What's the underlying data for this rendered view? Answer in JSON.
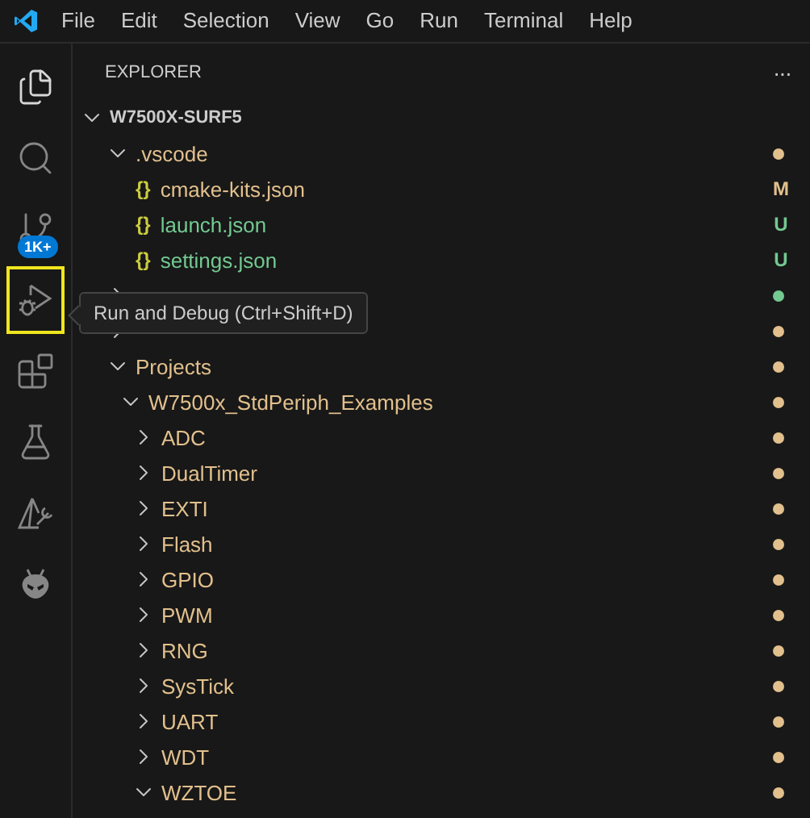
{
  "menu_bar": [
    "File",
    "Edit",
    "Selection",
    "View",
    "Go",
    "Run",
    "Terminal",
    "Help"
  ],
  "activity_bar": [
    {
      "kind": "explorer",
      "selected": true,
      "focused": false
    },
    {
      "kind": "search",
      "selected": false,
      "focused": false
    },
    {
      "kind": "source-control",
      "selected": false,
      "focused": false,
      "badge": "1K+"
    },
    {
      "kind": "run-debug",
      "selected": false,
      "focused": true
    },
    {
      "kind": "extensions",
      "selected": false,
      "focused": false
    },
    {
      "kind": "testing",
      "selected": false,
      "focused": false
    },
    {
      "kind": "cmake",
      "selected": false,
      "focused": false
    },
    {
      "kind": "platformio",
      "selected": false,
      "focused": false
    }
  ],
  "tooltip": "Run and Debug (Ctrl+Shift+D)",
  "explorer": {
    "title": "EXPLORER",
    "more": "···",
    "root": {
      "label": "W7500X-SURF5",
      "expanded": true,
      "children": [
        {
          "kind": "folder",
          "label": ".vscode",
          "expanded": true,
          "color": "#e2c08d",
          "children": [
            {
              "kind": "file",
              "icon": "{}",
              "label": "cmake-kits.json",
              "color": "#e2c08d",
              "badge": "M"
            },
            {
              "kind": "file",
              "icon": "{}",
              "label": "launch.json",
              "color": "#73c991",
              "badge": "U"
            },
            {
              "kind": "file",
              "icon": "{}",
              "label": "settings.json",
              "color": "#73c991",
              "badge": "U"
            }
          ]
        },
        {
          "kind": "folder",
          "expanded": false,
          "color": "#73c991"
        },
        {
          "kind": "folder",
          "expanded": false,
          "color": "#e2c08d"
        },
        {
          "kind": "folder",
          "label": "Projects",
          "expanded": true,
          "color": "#e2c08d",
          "children": [
            {
              "kind": "folder",
              "label": "W7500x_StdPeriph_Examples",
              "expanded": true,
              "color": "#e2c08d",
              "children": [
                {
                  "kind": "folder",
                  "label": "ADC",
                  "expanded": false,
                  "color": "#e2c08d"
                },
                {
                  "kind": "folder",
                  "label": "DualTimer",
                  "expanded": false,
                  "color": "#e2c08d"
                },
                {
                  "kind": "folder",
                  "label": "EXTI",
                  "expanded": false,
                  "color": "#e2c08d"
                },
                {
                  "kind": "folder",
                  "label": "Flash",
                  "expanded": false,
                  "color": "#e2c08d"
                },
                {
                  "kind": "folder",
                  "label": "GPIO",
                  "expanded": false,
                  "color": "#e2c08d"
                },
                {
                  "kind": "folder",
                  "label": "PWM",
                  "expanded": false,
                  "color": "#e2c08d"
                },
                {
                  "kind": "folder",
                  "label": "RNG",
                  "expanded": false,
                  "color": "#e2c08d"
                },
                {
                  "kind": "folder",
                  "label": "SysTick",
                  "expanded": false,
                  "color": "#e2c08d"
                },
                {
                  "kind": "folder",
                  "label": "UART",
                  "expanded": false,
                  "color": "#e2c08d"
                },
                {
                  "kind": "folder",
                  "label": "WDT",
                  "expanded": false,
                  "color": "#e2c08d"
                },
                {
                  "kind": "folder",
                  "label": "WZTOE",
                  "expanded": true,
                  "color": "#e2c08d"
                }
              ]
            }
          ]
        }
      ]
    }
  }
}
